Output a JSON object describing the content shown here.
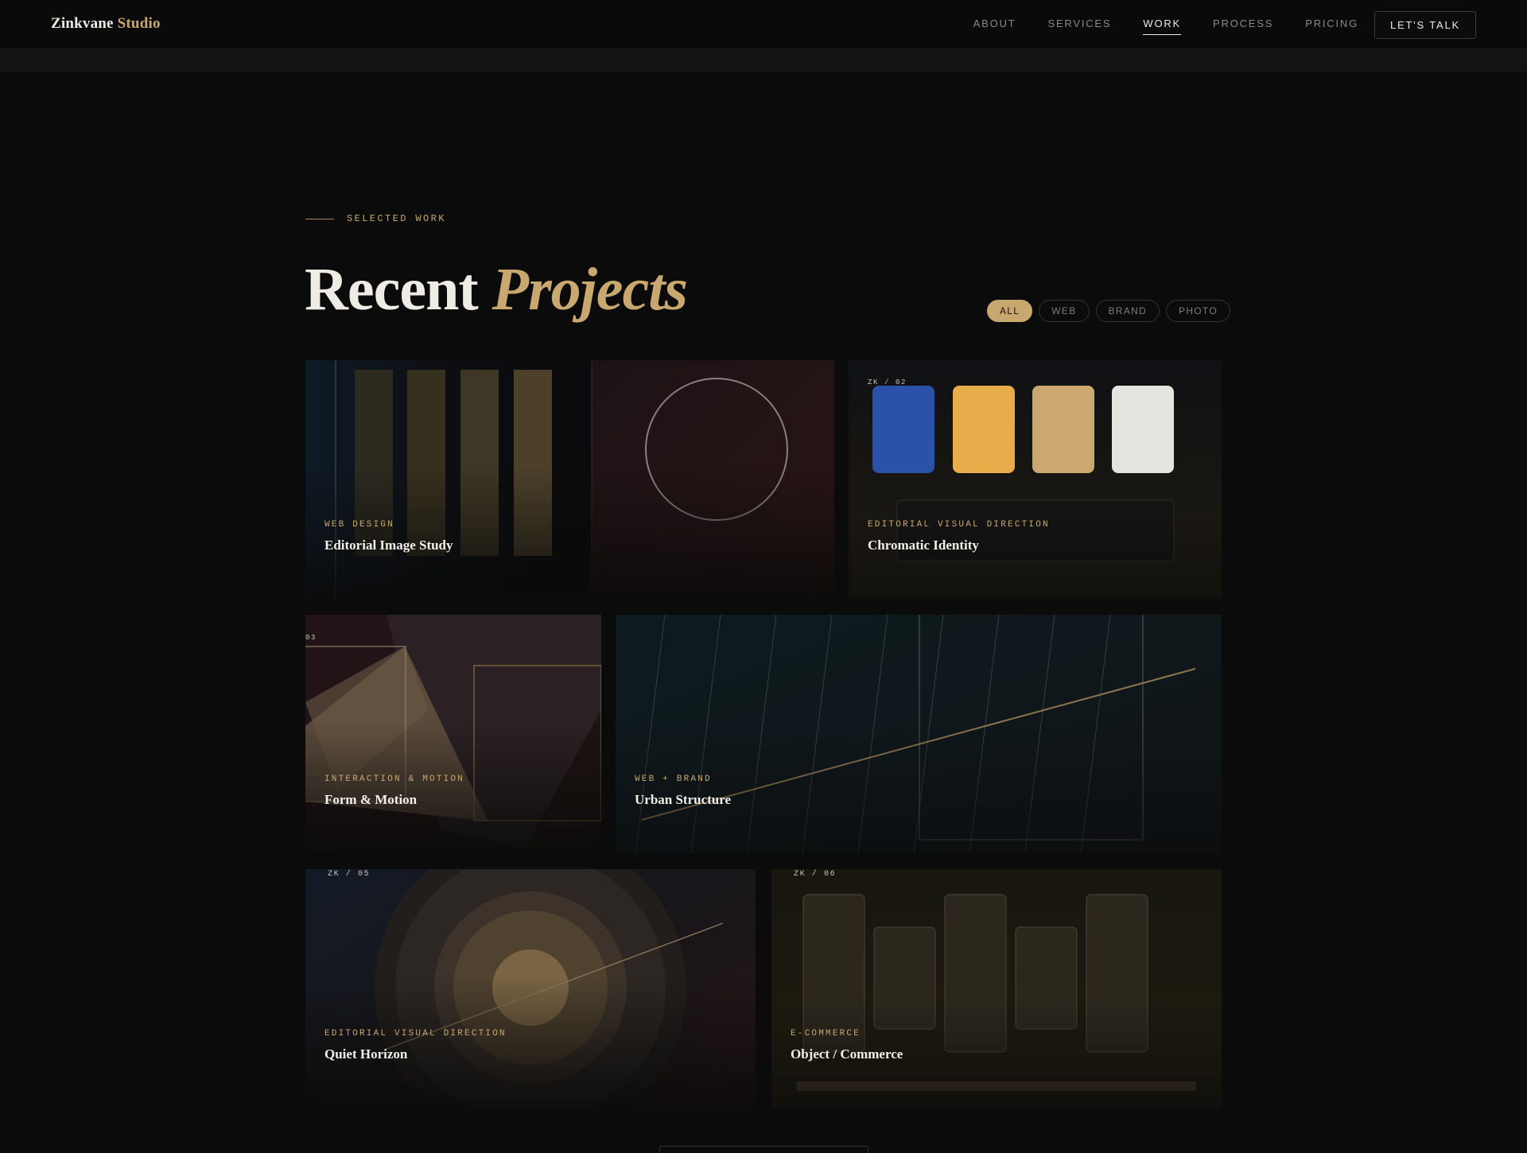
{
  "brand": {
    "name": "Zinkvane",
    "accent": "Studio"
  },
  "nav": {
    "links": [
      "ABOUT",
      "SERVICES",
      "WORK",
      "PROCESS",
      "PRICING"
    ],
    "active": "WORK",
    "cta": "LET'S TALK"
  },
  "section": {
    "eyebrow": "SELECTED WORK",
    "title_main": "Recent",
    "title_accent": "Projects"
  },
  "filters": {
    "options": [
      "ALL",
      "WEB",
      "BRAND",
      "PHOTO"
    ],
    "active": "ALL"
  },
  "projects": [
    {
      "category": "WEB DESIGN",
      "title": "Editorial Image Study"
    },
    {
      "code": "ZK / 02",
      "category": "EDITORIAL VISUAL DIRECTION",
      "title": "Chromatic Identity",
      "swatches": [
        "#2a52a8",
        "#e8ac4a",
        "#caa870",
        "#e5e4de"
      ]
    },
    {
      "code": "03",
      "category": "INTERACTION & MOTION",
      "title": "Form & Motion"
    },
    {
      "category": "WEB + BRAND",
      "title": "Urban Structure"
    },
    {
      "code": "ZK / 05",
      "category": "EDITORIAL VISUAL DIRECTION",
      "title": "Quiet Horizon"
    },
    {
      "code": "ZK / 06",
      "category": "E-COMMERCE",
      "title": "Object / Commerce"
    }
  ],
  "colors": {
    "background": "#0b0b0b",
    "accent": "#c9a86f",
    "text": "#efece6",
    "muted": "#8e8a84"
  }
}
